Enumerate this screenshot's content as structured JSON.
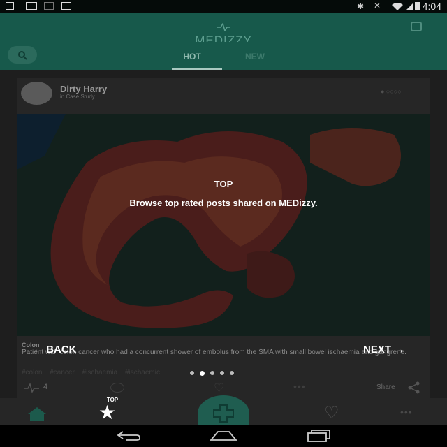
{
  "status_bar": {
    "time": "4:04"
  },
  "header": {
    "logo_text": "MEDIZZY"
  },
  "tabs": {
    "hot": "HOT",
    "new": "NEW"
  },
  "post": {
    "author": "Dirty Harry",
    "category": "in Case Study",
    "title": "Colon",
    "body": "Patient with colon cancer who had a concurrent shower of embolus from the SMA with small bowel ischaemia and gangrene.",
    "tags": "#colon #cancer #ischaemia #ischaemic",
    "like_count": "4",
    "share_label": "Share"
  },
  "overlay": {
    "title": "TOP",
    "description": "Browse top rated posts shared on MEDizzy.",
    "back_label": "← BACK",
    "next_label": "NEXT →",
    "page_count": 5,
    "current_page": 2
  },
  "bottom_nav": {
    "top_label": "TOP"
  },
  "colors": {
    "brand_green": "#17594b",
    "overlay_text": "#ffffff"
  }
}
